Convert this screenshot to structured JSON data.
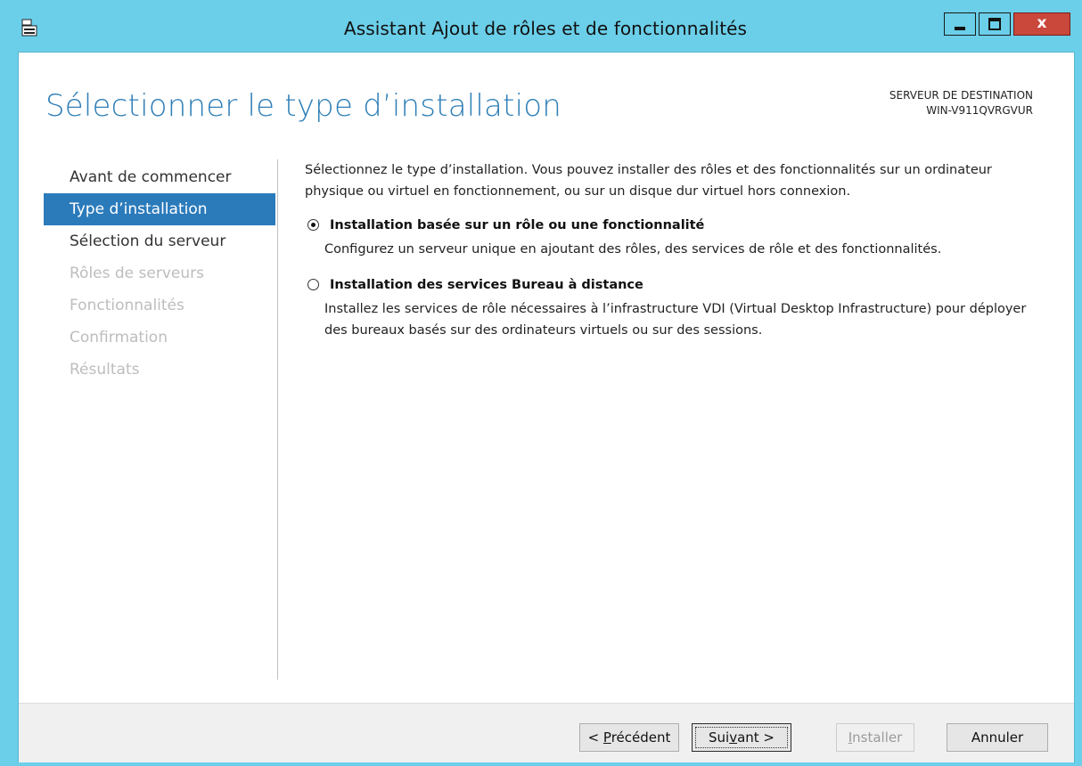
{
  "window": {
    "title": "Assistant Ajout de rôles et de fonctionnalités",
    "icon": "server-manager-icon",
    "controls": {
      "minimize": "minimize-icon",
      "maximize": "maximize-icon",
      "close": "x"
    },
    "title_bar_color": "#6bcfe9",
    "close_color": "#c9483b"
  },
  "header": {
    "page_title": "Sélectionner le type d’installation",
    "destination_label": "SERVEUR DE DESTINATION",
    "destination_server": "WIN-V911QVRGVUR"
  },
  "nav": {
    "items": [
      {
        "label": "Avant de commencer",
        "state": "normal"
      },
      {
        "label": "Type d’installation",
        "state": "active"
      },
      {
        "label": "Sélection du serveur",
        "state": "normal"
      },
      {
        "label": "Rôles de serveurs",
        "state": "disabled"
      },
      {
        "label": "Fonctionnalités",
        "state": "disabled"
      },
      {
        "label": "Confirmation",
        "state": "disabled"
      },
      {
        "label": "Résultats",
        "state": "disabled"
      }
    ],
    "active_color": "#2b7bbb"
  },
  "main": {
    "intro": "Sélectionnez le type d’installation. Vous pouvez installer des rôles et des fonctionnalités sur un ordinateur physique ou virtuel en fonctionnement, ou sur un disque dur virtuel hors connexion.",
    "options": [
      {
        "label": "Installation basée sur un rôle ou une fonctionnalité",
        "description": "Configurez un serveur unique en ajoutant des rôles, des services de rôle et des fonctionnalités.",
        "selected": true
      },
      {
        "label": "Installation des services Bureau à distance",
        "description": "Installez les services de rôle nécessaires à l’infrastructure VDI (Virtual Desktop Infrastructure) pour déployer des bureaux basés sur des ordinateurs virtuels ou sur des sessions.",
        "selected": false
      }
    ]
  },
  "footer": {
    "previous": {
      "prefix": "< ",
      "accel": "P",
      "rest": "récédent"
    },
    "next": {
      "prefix": "Sui",
      "accel": "v",
      "rest": "ant >"
    },
    "install": {
      "prefix": "",
      "accel": "I",
      "rest": "nstaller"
    },
    "cancel": "Annuler"
  }
}
